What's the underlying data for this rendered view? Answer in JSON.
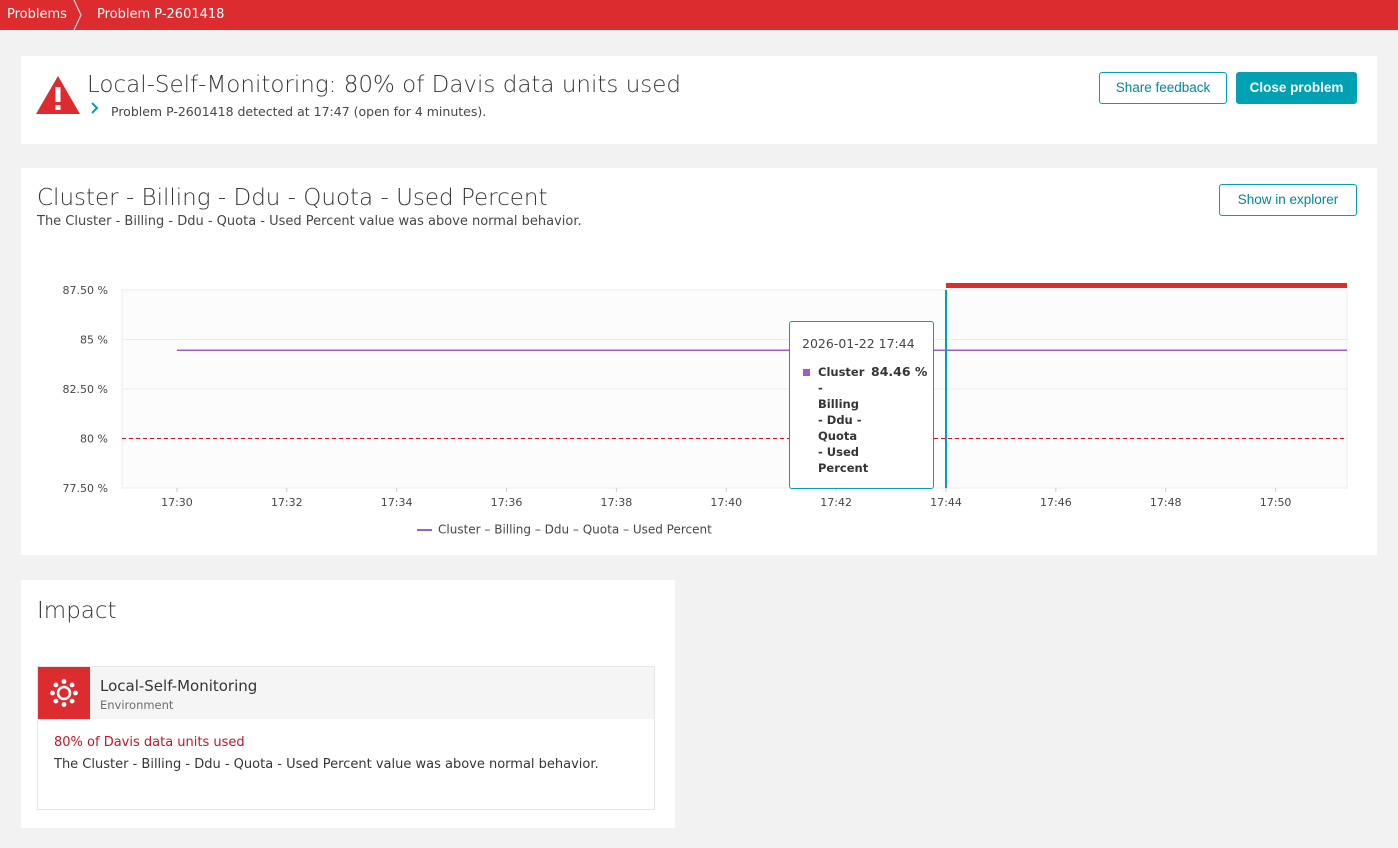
{
  "breadcrumb": {
    "items": [
      "Problems",
      "Problem P-2601418"
    ]
  },
  "header": {
    "title": "Local-Self-Monitoring: 80% of Davis data units used",
    "subtitle": "Problem P-2601418 detected at 17:47 (open for 4 minutes).",
    "share_feedback_label": "Share feedback",
    "close_problem_label": "Close problem"
  },
  "chart_card": {
    "title": "Cluster - Billing - Ddu - Quota - Used Percent",
    "subtitle": "The Cluster - Billing - Ddu - Quota - Used Percent value was above normal behavior.",
    "show_in_explorer_label": "Show in explorer"
  },
  "chart_data": {
    "type": "line",
    "y_ticks": [
      "87.50 %",
      "85 %",
      "82.50 %",
      "80 %",
      "77.50 %"
    ],
    "y_tick_values": [
      87.5,
      85,
      82.5,
      80,
      77.5
    ],
    "ylim": [
      77.5,
      87.5
    ],
    "x_ticks": [
      "17:30",
      "17:32",
      "17:34",
      "17:36",
      "17:38",
      "17:40",
      "17:42",
      "17:44",
      "17:46",
      "17:48",
      "17:50"
    ],
    "x_tick_minutes": [
      1050,
      1052,
      1054,
      1056,
      1058,
      1060,
      1062,
      1064,
      1066,
      1068,
      1070
    ],
    "xlim": [
      1049,
      1071.3
    ],
    "series": [
      {
        "name": "Cluster – Billing – Ddu – Quota – Used Percent",
        "color": "#9c5fc7",
        "x_start": 1050,
        "x_end": 1071.3,
        "value": 84.46
      }
    ],
    "threshold": {
      "value": 80,
      "color": "#c41425"
    },
    "problem_window": {
      "x_start": 1064,
      "x_end": 1071.3,
      "color": "#dc2c30"
    },
    "cursor_minute": 1064,
    "grid": true,
    "legend_placement": "bottom"
  },
  "tooltip": {
    "date": "2026-01-22 17:44",
    "series_name": "Cluster - Billing - Ddu - Quota - Used Percent",
    "value": "84.46 %"
  },
  "legend": {
    "label": "Cluster – Billing – Ddu – Quota – Used Percent"
  },
  "impact": {
    "title": "Impact",
    "entity_name": "Local-Self-Monitoring",
    "entity_type": "Environment",
    "event_title": "80% of Davis data units used",
    "event_description": "The Cluster - Billing - Ddu - Quota - Used Percent value was above normal behavior."
  }
}
